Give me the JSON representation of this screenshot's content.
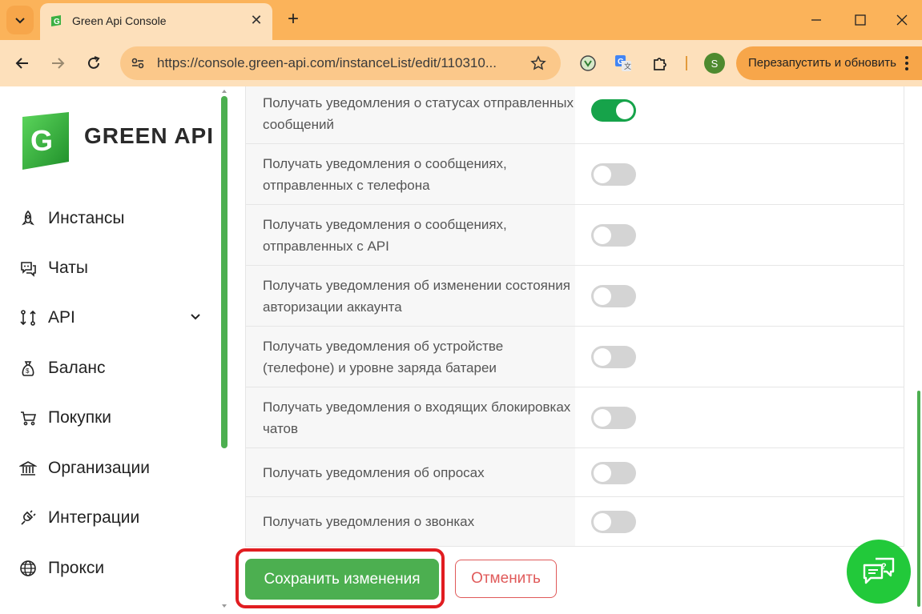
{
  "browser": {
    "tab_title": "Green Api Console",
    "url": "https://console.green-api.com/instanceList/edit/110310...",
    "profile_initial": "S",
    "restart_label": "Перезапустить и обновить"
  },
  "sidebar": {
    "logo_text": "GREEN API",
    "items": [
      {
        "label": "Инстансы",
        "icon": "rocket-icon"
      },
      {
        "label": "Чаты",
        "icon": "chat-bubbles-icon"
      },
      {
        "label": "API",
        "icon": "api-icon"
      },
      {
        "label": "Баланс",
        "icon": "money-bag-icon"
      },
      {
        "label": "Покупки",
        "icon": "cart-icon"
      },
      {
        "label": "Организации",
        "icon": "bank-icon"
      },
      {
        "label": "Интеграции",
        "icon": "plug-icon"
      },
      {
        "label": "Прокси",
        "icon": "globe-icon"
      }
    ]
  },
  "settings": {
    "rows": [
      {
        "label": "Получать уведомления о статусах отправленных сообщений",
        "enabled": true
      },
      {
        "label": "Получать уведомления о сообщениях, отправленных с телефона",
        "enabled": false
      },
      {
        "label": "Получать уведомления о сообщениях, отправленных с API",
        "enabled": false
      },
      {
        "label": "Получать уведомления об изменении состояния авторизации аккаунта",
        "enabled": false
      },
      {
        "label": "Получать уведомления об устройстве (телефоне) и уровне заряда батареи",
        "enabled": false
      },
      {
        "label": "Получать уведомления о входящих блокировках чатов",
        "enabled": false
      },
      {
        "label": "Получать уведомления об опросах",
        "enabled": false
      },
      {
        "label": "Получать уведомления о звонках",
        "enabled": false
      }
    ]
  },
  "actions": {
    "save_label": "Сохранить изменения",
    "cancel_label": "Отменить"
  },
  "colors": {
    "accent_green": "#4caf50",
    "toggle_on": "#16a34a",
    "highlight_red": "#e11d21",
    "cancel_red": "#e05a5a"
  }
}
